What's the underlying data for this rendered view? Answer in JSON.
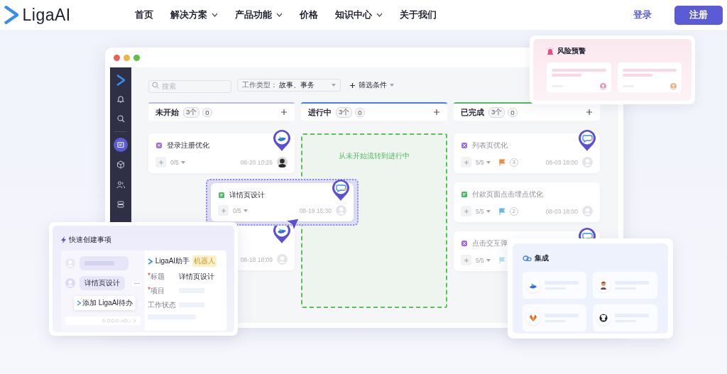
{
  "nav": {
    "logo": "LigaAI",
    "items": [
      {
        "label": "首页",
        "has_menu": false
      },
      {
        "label": "解决方案",
        "has_menu": true
      },
      {
        "label": "产品功能",
        "has_menu": true
      },
      {
        "label": "价格",
        "has_menu": false
      },
      {
        "label": "知识中心",
        "has_menu": true
      },
      {
        "label": "关于我们",
        "has_menu": false
      }
    ],
    "login": "登录",
    "signup": "注册"
  },
  "board": {
    "sidebar": [
      {
        "kind": "bell",
        "selected": false
      },
      {
        "kind": "search",
        "selected": false
      },
      {
        "kind": "board",
        "selected": true
      },
      {
        "kind": "cube",
        "selected": false
      },
      {
        "kind": "people",
        "selected": false
      },
      {
        "kind": "layers",
        "selected": false
      }
    ],
    "search": {
      "placeholder": "搜索"
    },
    "type_filter": {
      "label": "工作类型：",
      "value": "故事、事务"
    },
    "add_filter": "筛选条件",
    "columns": [
      {
        "title": "未开始",
        "count": "3个",
        "extra": "0",
        "color": "#b8bde3",
        "cards": [
          {
            "kind": "story",
            "title": "登录注册优化",
            "progress": "0/5",
            "date": "08-20 10:26",
            "avatar": {
              "kind": "photo"
            },
            "pin": {
              "kind": "wave"
            },
            "done": false
          },
          {
            "date": "08-18 18:09",
            "avatar": {
              "kind": "placeholder"
            },
            "pin": {
              "kind": "wave"
            }
          }
        ]
      },
      {
        "title": "进行中",
        "count": "3个",
        "extra": "0",
        "color": "#4b7cf3",
        "drop_zone": "从未开始流转到进行中"
      },
      {
        "title": "已完成",
        "count": "3个",
        "extra": "0",
        "color": "#4dbb5f",
        "cards": [
          {
            "kind": "story",
            "title": "列表页优化",
            "progress": "5/5",
            "flag": {
              "color": "#f0883a"
            },
            "comments": "3",
            "date": "08-03 18:00",
            "avatar": {
              "kind": "placeholder"
            },
            "pin": {
              "kind": "chat"
            },
            "done": true
          },
          {
            "kind": "task",
            "title": "付款页面点击埋点优化",
            "progress": "5/5",
            "flag": {
              "color": "#5fb8e8"
            },
            "comments": "2",
            "date": "08-03 18:00",
            "avatar": {
              "kind": "placeholder"
            },
            "done": true
          },
          {
            "kind": "story",
            "title": "点击交互弹",
            "progress": "5/5",
            "flag": {
              "color": "#b5e2ef"
            },
            "pin": {
              "kind": "chat"
            },
            "done": true
          }
        ]
      }
    ],
    "dragged_card": {
      "kind": "task",
      "title": "详情页设计",
      "progress": "0/5",
      "date": "08-19 15:30",
      "avatar": {
        "kind": "placeholder"
      },
      "pin": {
        "kind": "chat"
      },
      "done": false
    }
  },
  "risk": {
    "title": "风险预警",
    "items": [
      {
        "color": "#e89ab3"
      },
      {
        "color": "#f2b27d"
      }
    ]
  },
  "quick_create": {
    "title": "快速创建事项",
    "messages": [
      {
        "kind": "skeleton"
      },
      {
        "kind": "text",
        "text": "详情页设计"
      }
    ],
    "action": "添加 LigaAI待办",
    "assistant": {
      "name": "LigaAI助手",
      "badge": "机器人",
      "fields": [
        {
          "mark": "*",
          "label": "标题",
          "value": "详情页设计"
        },
        {
          "mark": "*",
          "label": "项目"
        },
        {
          "label": "工作状态"
        }
      ]
    }
  },
  "integrations": {
    "title": "集成",
    "items": [
      {
        "kind": "wave"
      },
      {
        "kind": "figure"
      },
      {
        "kind": "fox"
      },
      {
        "kind": "cat"
      }
    ]
  }
}
